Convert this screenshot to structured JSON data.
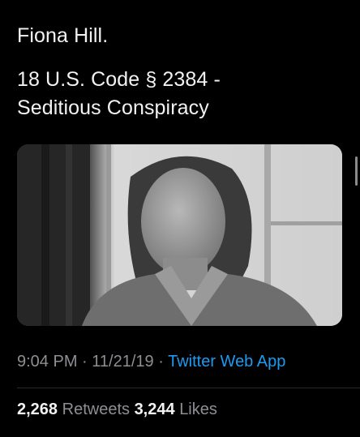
{
  "tweet": {
    "lines": [
      "Fiona Hill.",
      "18 U.S. Code § 2384 -",
      "Seditious Conspiracy"
    ],
    "time": "9:04 PM",
    "date": "11/21/19",
    "separator": "·",
    "source": "Twitter Web App",
    "retweets_count": "2,268",
    "retweets_label": "Retweets",
    "likes_count": "3,244",
    "likes_label": "Likes",
    "media": {
      "type": "photo",
      "style": "black-and-white portrait"
    }
  },
  "colors": {
    "background": "#000000",
    "text": "#f2f2f2",
    "muted": "#8e8e93",
    "link": "#1d9bf0"
  }
}
